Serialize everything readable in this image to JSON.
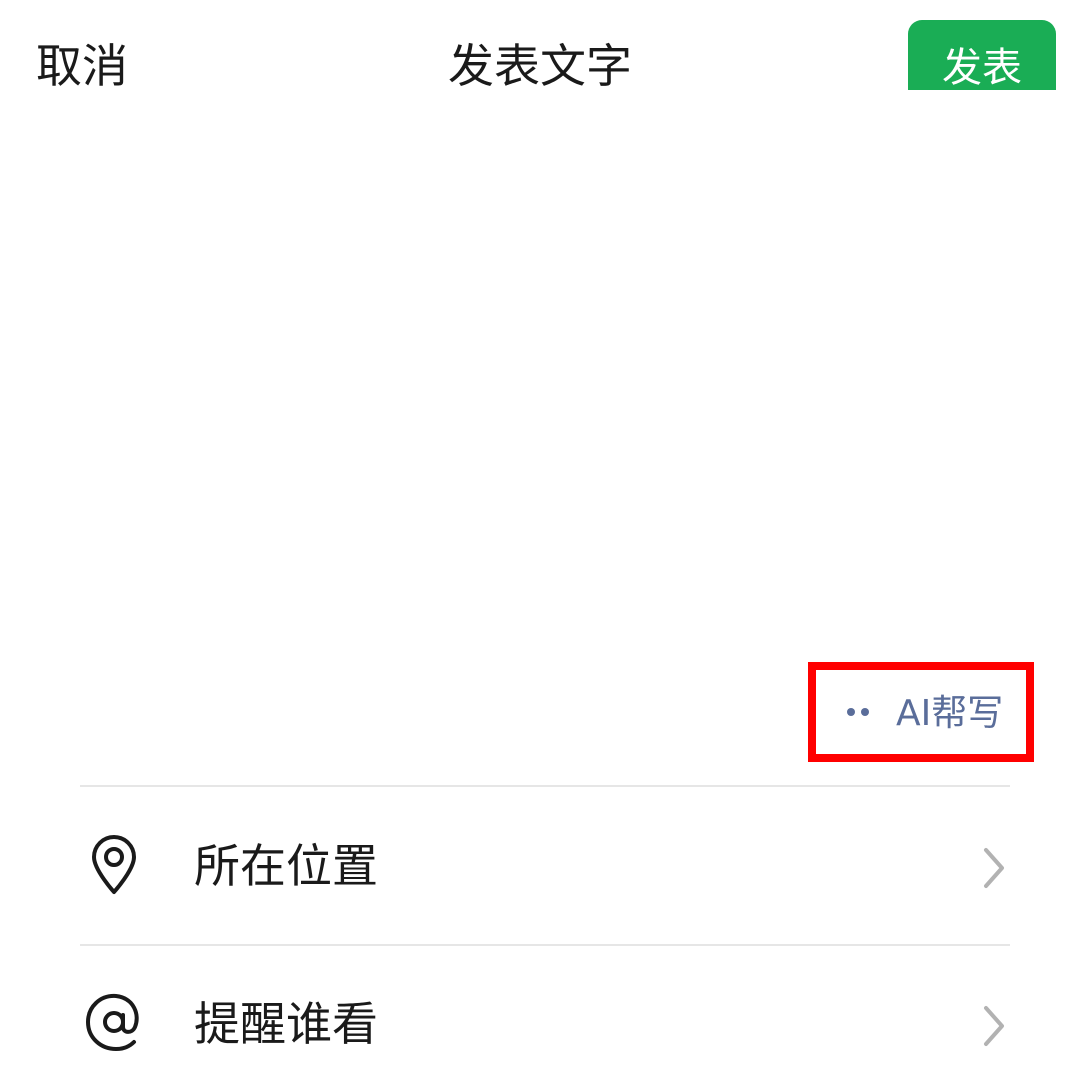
{
  "header": {
    "cancel_label": "取消",
    "title": "发表文字",
    "post_label": "发表"
  },
  "compose": {
    "text": ""
  },
  "ai_assist": {
    "label": "AI帮写",
    "icon": "dots-icon"
  },
  "options": [
    {
      "label": "所在位置",
      "icon": "location-pin-icon"
    },
    {
      "label": "提醒谁看",
      "icon": "at-sign-icon"
    }
  ],
  "colors": {
    "accent_green": "#1aad55",
    "ai_text": "#5a6d9a",
    "highlight_box": "#ff0000"
  }
}
